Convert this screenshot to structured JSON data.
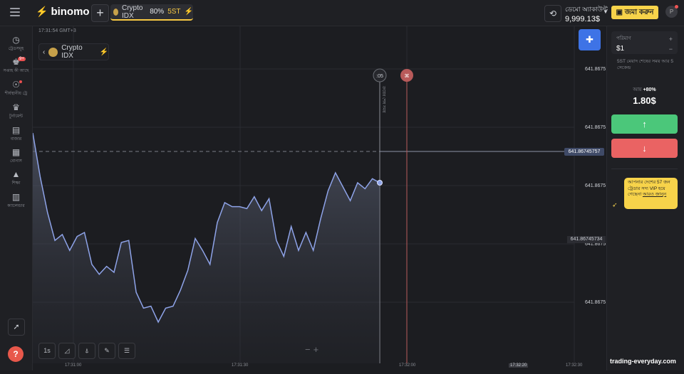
{
  "topbar": {
    "logo": "binomo",
    "asset_tab": {
      "name": "Crypto IDX",
      "payout": "80%",
      "tag": "5ST"
    },
    "account": {
      "label": "ডেমো অ্যাকাউন্ট",
      "balance": "9,999.13$"
    },
    "deposit_label": "জমা করুন",
    "avatar_letter": "P"
  },
  "sidebar": {
    "items": [
      {
        "label": "ট্রেডসমূহ",
        "icon": "clock-icon"
      },
      {
        "label": "সপ্তাহ কী আছে",
        "icon": "trophy-cup-icon",
        "badge": "9+"
      },
      {
        "label": "শীর্ষস্থানীয় ট্রে",
        "icon": "leaders-icon"
      },
      {
        "label": "টুর্নামেন্ট",
        "icon": "tournament-icon"
      },
      {
        "label": "বাজার",
        "icon": "market-icon"
      },
      {
        "label": "বোনাস",
        "icon": "gift-icon"
      },
      {
        "label": "শিক্ষা",
        "icon": "education-icon"
      },
      {
        "label": "ক্যালেন্ডার",
        "icon": "calendar-icon"
      }
    ]
  },
  "chart": {
    "server_time": "17:31:54 GMT+3",
    "asset_name": "Crypto IDX",
    "timer_label": ":05",
    "vertical_label": "ক্রয়ের শেষ সময়",
    "current_price": "641.86745757",
    "level_price": "641.86745734",
    "timeframe": "1s",
    "price_labels": [
      "641.8675",
      "641.8675",
      "641.8675",
      "641.8675",
      "641.8675"
    ],
    "time_labels": [
      "17:31:00",
      "17:31:30",
      "17:32:00",
      "17:32:20",
      "17:32:30"
    ]
  },
  "chart_data": {
    "type": "area",
    "x": [
      "17:31:00",
      "17:31:30",
      "17:32:00"
    ],
    "series": [
      {
        "values": [
          100,
          78,
          60,
          46,
          49,
          41,
          48,
          50,
          34,
          29,
          33,
          30,
          45,
          46,
          20,
          12,
          13,
          5,
          12,
          13,
          21,
          31,
          47,
          41,
          34,
          55,
          65,
          63,
          63,
          62,
          68,
          61,
          67,
          46,
          38,
          53,
          41,
          50,
          41,
          57,
          71,
          80,
          73,
          66,
          75,
          72,
          77,
          75
        ]
      }
    ],
    "ylim": [
      0,
      100
    ]
  },
  "right_panel": {
    "amount_label": "পরিমাণ",
    "amount_value": "$1",
    "expiry_note": "5ST মেয়াদ শেষের সময় আর 5 সেকেন্ড",
    "payout_label": "আয়",
    "payout_pct": "+80%",
    "payout_value": "1.80$",
    "promo_text": "আপনার দেশের 57 জন ট্রেডার সদ্য VIP হয়ে গেছেন!",
    "promo_link": "আরও জানুন"
  },
  "watermark": "trading-everyday.com",
  "colors": {
    "up": "#4bc77a",
    "down": "#ea6363",
    "accent": "#f7d34a",
    "line": "#8ea3e8"
  }
}
